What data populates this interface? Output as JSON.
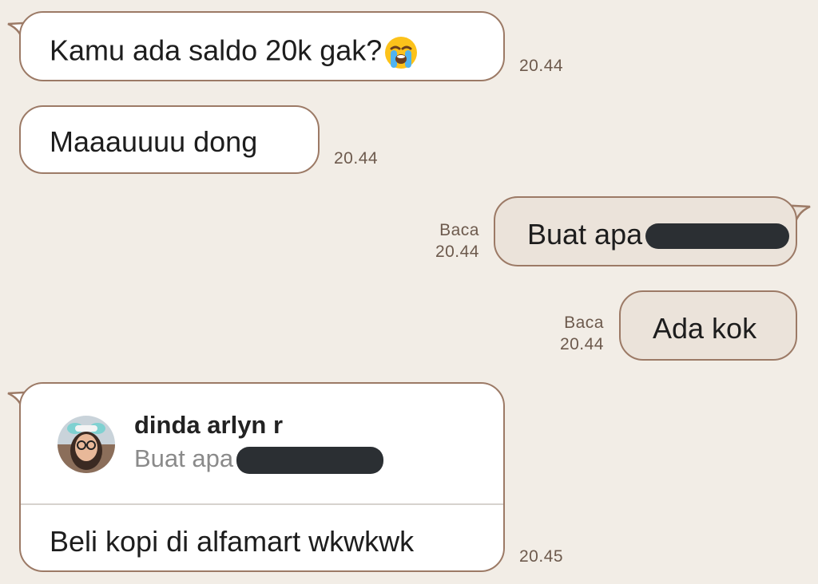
{
  "messages": [
    {
      "direction": "incoming",
      "text": "Kamu ada saldo 20k gak?",
      "emoji": "loudly-crying-face-icon",
      "time": "20.44"
    },
    {
      "direction": "incoming",
      "text": "Maaauuuu dong",
      "time": "20.44"
    },
    {
      "direction": "outgoing",
      "text": "Buat apa",
      "redacted": true,
      "status": "Baca",
      "time": "20.44"
    },
    {
      "direction": "outgoing",
      "text": "Ada kok",
      "status": "Baca",
      "time": "20.44"
    },
    {
      "direction": "incoming",
      "reply_to": {
        "name": "dinda arlyn r",
        "text": "Buat apa",
        "redacted": true
      },
      "text": "Beli kopi di alfamart wkwkwk",
      "time": "20.45"
    }
  ],
  "colors": {
    "background": "#f2ede6",
    "incoming_bubble": "#ffffff",
    "outgoing_bubble": "#ebe3da",
    "bubble_border": "#9c7a66",
    "redaction": "#2b2f33"
  }
}
